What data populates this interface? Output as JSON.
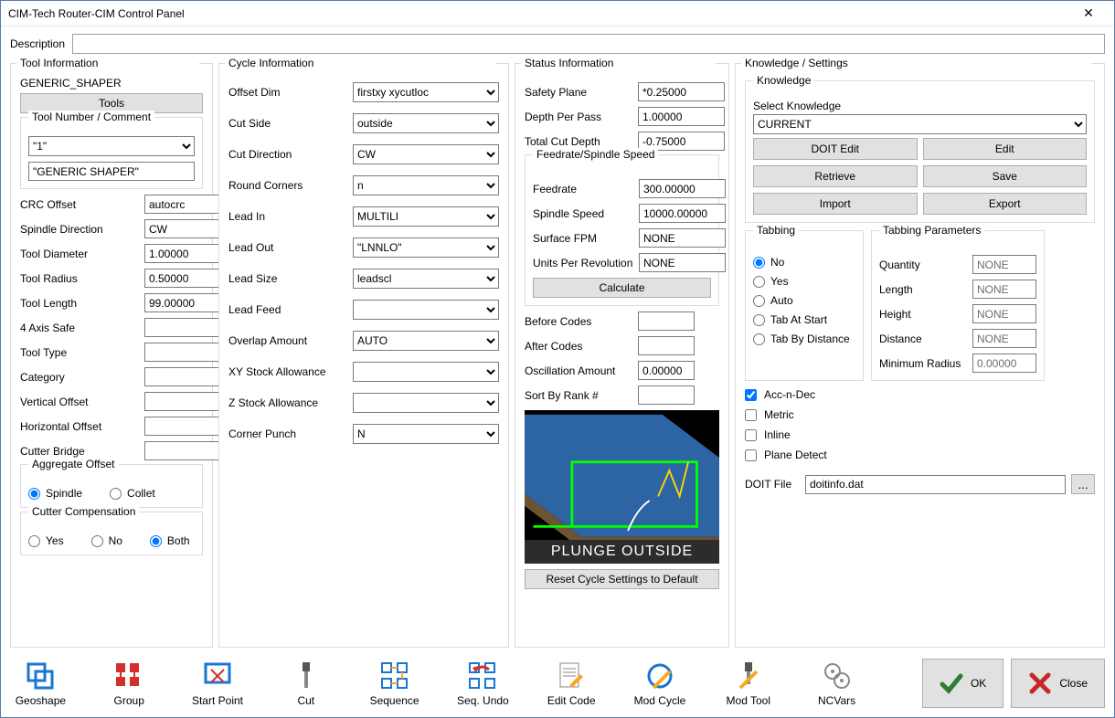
{
  "window": {
    "title": "CIM-Tech Router-CIM Control Panel"
  },
  "description": {
    "label": "Description",
    "value": ""
  },
  "tool_info": {
    "legend": "Tool Information",
    "shaper": "GENERIC_SHAPER",
    "tools_btn": "Tools",
    "number_comment_legend": "Tool Number / Comment",
    "tool_number": "\"1\"",
    "tool_comment": "\"GENERIC SHAPER\"",
    "crc_offset_label": "CRC Offset",
    "crc_offset": "autocrc",
    "spindle_dir_label": "Spindle Direction",
    "spindle_dir": "CW",
    "tool_dia_label": "Tool Diameter",
    "tool_dia": "1.00000",
    "tool_rad_label": "Tool Radius",
    "tool_rad": "0.50000",
    "tool_len_label": "Tool Length",
    "tool_len": "99.00000",
    "axis_safe_label": "4 Axis Safe",
    "axis_safe": "",
    "tool_type_label": "Tool Type",
    "tool_type": "",
    "category_label": "Category",
    "category": "",
    "voff_label": "Vertical Offset",
    "voff": "",
    "hoff_label": "Horizontal Offset",
    "hoff": "",
    "cutter_bridge_label": "Cutter Bridge",
    "cutter_bridge": "",
    "agg_legend": "Aggregate Offset",
    "agg_spindle": "Spindle",
    "agg_collet": "Collet",
    "cc_legend": "Cutter Compensation",
    "cc_yes": "Yes",
    "cc_no": "No",
    "cc_both": "Both"
  },
  "cycle": {
    "legend": "Cycle Information",
    "offset_dim_label": "Offset Dim",
    "offset_dim": "firstxy xycutloc",
    "cut_side_label": "Cut Side",
    "cut_side": "outside",
    "cut_dir_label": "Cut Direction",
    "cut_dir": "CW",
    "round_label": "Round Corners",
    "round": "n",
    "lead_in_label": "Lead In",
    "lead_in": "MULTILI",
    "lead_out_label": "Lead Out",
    "lead_out": "\"LNNLO\"",
    "lead_size_label": "Lead Size",
    "lead_size": "leadscl",
    "lead_feed_label": "Lead Feed",
    "lead_feed": "",
    "overlap_label": "Overlap Amount",
    "overlap": "AUTO",
    "xy_stock_label": "XY Stock Allowance",
    "xy_stock": "",
    "z_stock_label": "Z Stock Allowance",
    "z_stock": "",
    "corner_punch_label": "Corner Punch",
    "corner_punch": "N"
  },
  "status": {
    "legend": "Status Information",
    "safety_label": "Safety Plane",
    "safety": "*0.25000",
    "depth_label": "Depth Per Pass",
    "depth": "1.00000",
    "total_label": "Total Cut Depth",
    "total": "-0.75000",
    "frsp_legend": "Feedrate/Spindle Speed",
    "feedrate_label": "Feedrate",
    "feedrate": "300.00000",
    "spindle_label": "Spindle Speed",
    "spindle": "10000.00000",
    "surface_label": "Surface FPM",
    "surface": "NONE",
    "upr_label": "Units Per Revolution",
    "upr": "NONE",
    "calculate": "Calculate",
    "before_label": "Before Codes",
    "before": "",
    "after_label": "After Codes",
    "after": "",
    "osc_label": "Oscillation Amount",
    "osc": "0.00000",
    "sort_label": "Sort By Rank #",
    "sort": "",
    "plunge_label": "PLUNGE OUTSIDE",
    "reset": "Reset Cycle Settings to Default"
  },
  "knowledge": {
    "legend": "Knowledge / Settings",
    "sub_legend": "Knowledge",
    "select_label": "Select Knowledge",
    "select": "CURRENT",
    "doit_edit": "DOIT Edit",
    "edit": "Edit",
    "retrieve": "Retrieve",
    "save": "Save",
    "import": "Import",
    "export": "Export",
    "tabbing_legend": "Tabbing",
    "tab_no": "No",
    "tab_yes": "Yes",
    "tab_auto": "Auto",
    "tab_start": "Tab At Start",
    "tab_dist": "Tab By Distance",
    "tparam_legend": "Tabbing Parameters",
    "qty_label": "Quantity",
    "qty": "NONE",
    "len_label": "Length",
    "len": "NONE",
    "height_label": "Height",
    "height": "NONE",
    "dist_label": "Distance",
    "dist": "NONE",
    "minrad_label": "Minimum Radius",
    "minrad": "0.00000",
    "acc": "Acc-n-Dec",
    "metric": "Metric",
    "inline": "Inline",
    "plane": "Plane Detect",
    "doitfile_label": "DOIT File",
    "doitfile": "doitinfo.dat",
    "browse": "..."
  },
  "toolbar": {
    "geoshape": "Geoshape",
    "group": "Group",
    "start_point": "Start Point",
    "cut": "Cut",
    "sequence": "Sequence",
    "seq_undo": "Seq. Undo",
    "edit_code": "Edit Code",
    "mod_cycle": "Mod Cycle",
    "mod_tool": "Mod Tool",
    "ncvars": "NCVars",
    "ok": "OK",
    "close": "Close"
  }
}
